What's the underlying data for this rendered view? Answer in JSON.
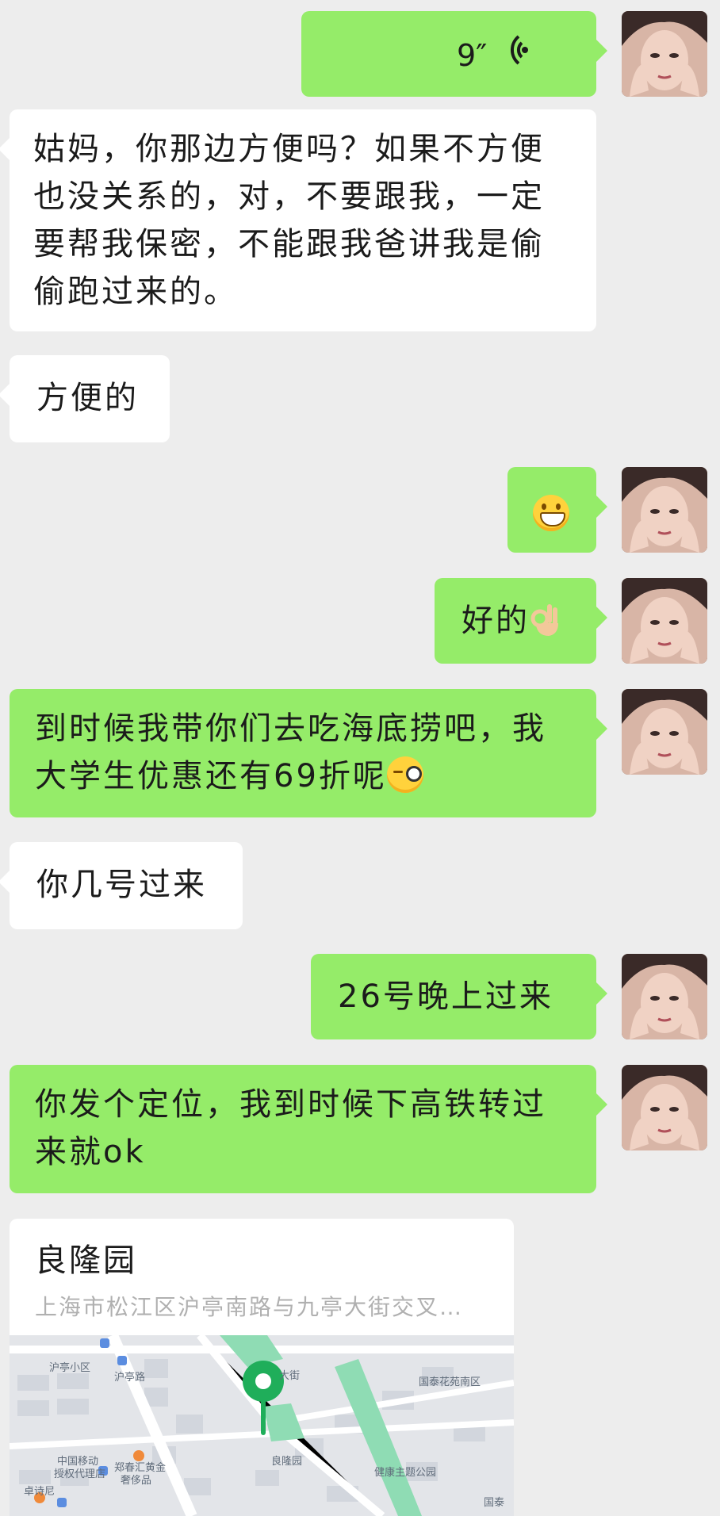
{
  "messages": [
    {
      "side": "right",
      "type": "voice",
      "duration": "9″"
    },
    {
      "side": "left",
      "type": "text",
      "text": "姑妈，你那边方便吗？如果不方便也没关系的，对，不要跟我，一定要帮我保密，不能跟我爸讲我是偷偷跑过来的。"
    },
    {
      "side": "left",
      "type": "text",
      "text": "方便的"
    },
    {
      "side": "right",
      "type": "emoji",
      "emoji": "grin-icon"
    },
    {
      "side": "right",
      "type": "text",
      "text": "好的",
      "emoji": "ok-hand-icon"
    },
    {
      "side": "right",
      "type": "text",
      "text": "到时候我带你们去吃海底捞吧，我大学生优惠还有69折呢",
      "emoji": "wink-icon"
    },
    {
      "side": "left",
      "type": "text",
      "text": "你几号过来"
    },
    {
      "side": "right",
      "type": "text",
      "text": "26号晚上过来"
    },
    {
      "side": "right",
      "type": "text",
      "text": "你发个定位，我到时候下高铁转过来就ok"
    },
    {
      "side": "left",
      "type": "location",
      "name": "良隆园",
      "address": "上海市松江区沪亭南路与九亭大街交叉…"
    }
  ],
  "map_labels": {
    "l1": "沪亭小区",
    "l2": "沪亭路",
    "l3": "大街",
    "l4": "国泰花苑南区",
    "l5": "中国移动",
    "l6": "授权代理店",
    "l7": "郑春汇黄金",
    "l8": "奢侈品",
    "l9": "良隆园",
    "l10": "卓诗尼",
    "l11": "健康主题公园",
    "l12": "国泰"
  },
  "colors": {
    "green_bubble": "#95ec69",
    "white_bubble": "#ffffff",
    "background": "#ededed",
    "pin": "#1fae5a"
  }
}
